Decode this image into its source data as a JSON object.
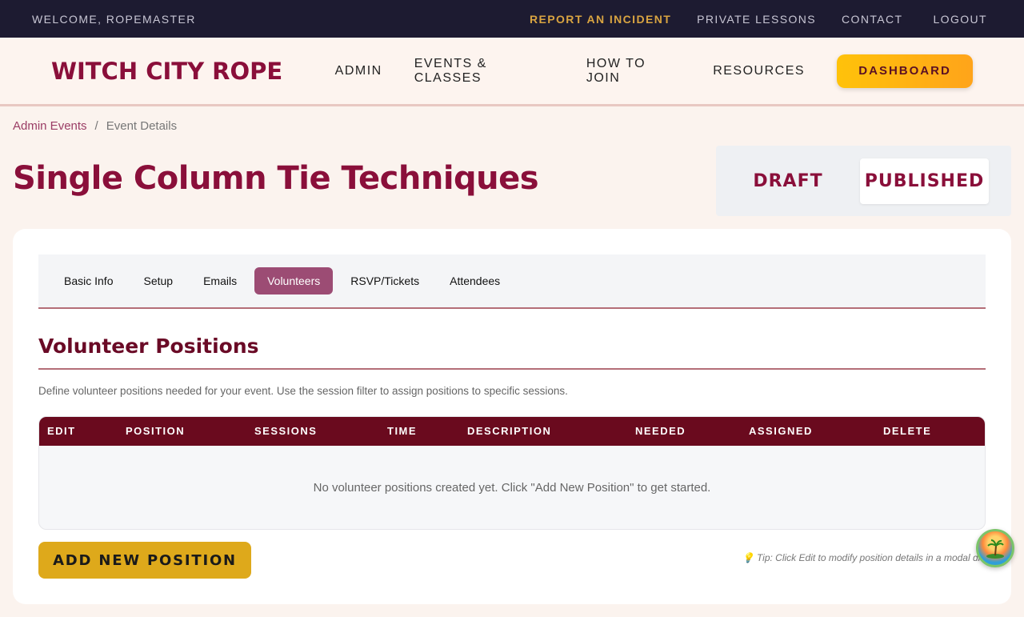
{
  "utility_bar": {
    "welcome": "WELCOME, ROPEMASTER",
    "report_incident": "REPORT AN INCIDENT",
    "private_lessons": "PRIVATE LESSONS",
    "contact": "CONTACT",
    "logout": "LOGOUT"
  },
  "header": {
    "logo": "WITCH CITY ROPE",
    "nav": [
      "ADMIN",
      "EVENTS & CLASSES",
      "HOW TO JOIN",
      "RESOURCES"
    ],
    "dashboard": "DASHBOARD"
  },
  "breadcrumb": {
    "parent": "Admin Events",
    "separator": "/",
    "current": "Event Details"
  },
  "page_title": "Single Column Tie Techniques",
  "status": {
    "draft": "DRAFT",
    "published": "PUBLISHED",
    "selected": "PUBLISHED"
  },
  "tabs": [
    {
      "label": "Basic Info",
      "active": false
    },
    {
      "label": "Setup",
      "active": false
    },
    {
      "label": "Emails",
      "active": false
    },
    {
      "label": "Volunteers",
      "active": true
    },
    {
      "label": "RSVP/Tickets",
      "active": false
    },
    {
      "label": "Attendees",
      "active": false
    }
  ],
  "volunteers": {
    "title": "Volunteer Positions",
    "description": "Define volunteer positions needed for your event. Use the session filter to assign positions to specific sessions.",
    "columns": [
      "EDIT",
      "POSITION",
      "SESSIONS",
      "TIME",
      "DESCRIPTION",
      "NEEDED",
      "ASSIGNED",
      "DELETE"
    ],
    "empty_message": "No volunteer positions created yet. Click \"Add New Position\" to get started.",
    "add_button": "ADD NEW POSITION",
    "tip": "💡 Tip: Click Edit to modify position details in a modal dialog"
  },
  "colors": {
    "brand": "#8a0f3a",
    "table_header": "#6a0a1e",
    "active_tab": "#9c4c74",
    "accent_gold": "#dea91b"
  },
  "icons": {
    "fab": "beach-island-icon"
  }
}
